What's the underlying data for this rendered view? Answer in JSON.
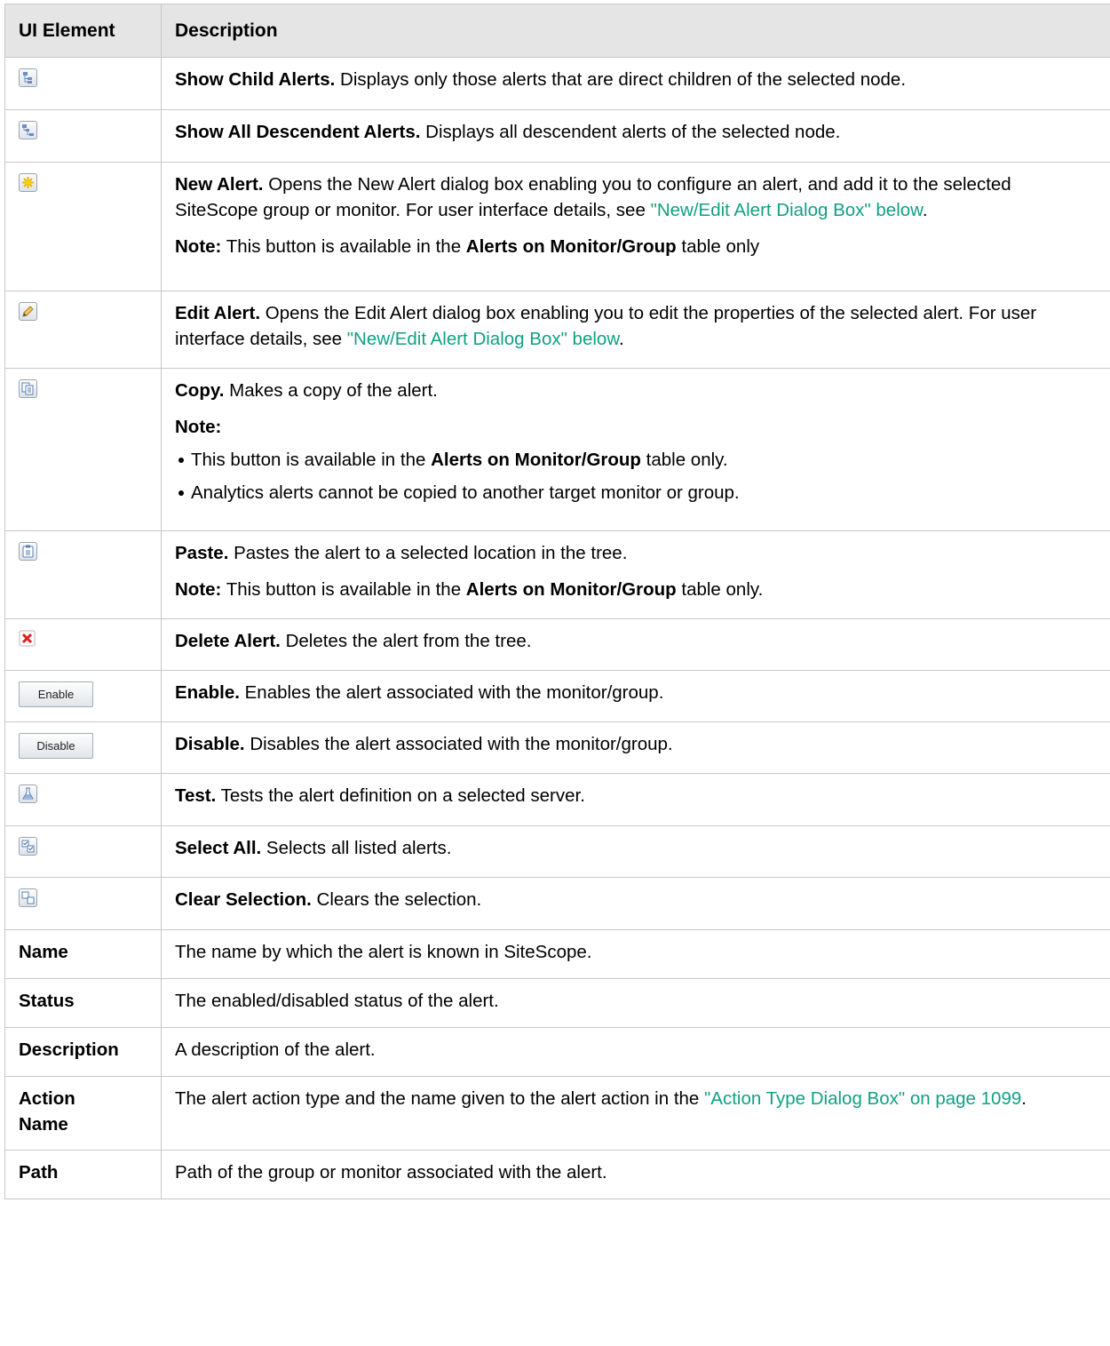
{
  "header": {
    "col1": "UI Element",
    "col2": "Description"
  },
  "rows": [
    {
      "icon": "show-child-alerts-icon",
      "title": "Show Child Alerts.",
      "text": " Displays only those alerts that are direct children of the selected node."
    },
    {
      "icon": "show-all-descendent-alerts-icon",
      "title": "Show All Descendent Alerts.",
      "text": " Displays all descendent alerts of the selected node."
    },
    {
      "icon": "new-alert-icon",
      "title": "New Alert.",
      "text": " Opens the New Alert dialog box enabling you to configure an alert, and add it to the selected SiteScope group or monitor. For user interface details, see ",
      "link": "\"New/Edit Alert Dialog Box\" below",
      "tail": ".",
      "note_label": "Note:",
      "note_pre": " This button is available in the ",
      "note_bold": "Alerts on Monitor/Group",
      "note_post": " table only"
    },
    {
      "icon": "edit-alert-icon",
      "title": "Edit Alert.",
      "text": " Opens the Edit Alert dialog box enabling you to edit the properties of the selected alert. For user interface details, see ",
      "link": "\"New/Edit Alert Dialog Box\" below",
      "tail": "."
    },
    {
      "icon": "copy-icon",
      "title": "Copy.",
      "text": " Makes a copy of the alert.",
      "note_label": "Note:",
      "bullet1_pre": "This button is available in the ",
      "bullet1_bold": "Alerts on Monitor/Group",
      "bullet1_post": " table only.",
      "bullet2": "Analytics alerts cannot be copied to another target monitor or group."
    },
    {
      "icon": "paste-icon",
      "title": "Paste.",
      "text": " Pastes the alert to a selected location in the tree.",
      "note_label": "Note:",
      "note_pre": " This button is available in the ",
      "note_bold": "Alerts on Monitor/Group",
      "note_post": " table only."
    },
    {
      "icon": "delete-alert-icon",
      "title": "Delete Alert.",
      "text": " Deletes the alert from the tree."
    },
    {
      "button": "Enable",
      "title": "Enable.",
      "text": " Enables the alert associated with the monitor/group."
    },
    {
      "button": "Disable",
      "title": "Disable.",
      "text": " Disables the alert associated with the monitor/group."
    },
    {
      "icon": "test-flask-icon",
      "title": "Test.",
      "text": " Tests the alert definition on a selected server."
    },
    {
      "icon": "select-all-icon",
      "title": "Select All.",
      "text": " Selects all listed alerts."
    },
    {
      "icon": "clear-selection-icon",
      "title": "Clear Selection.",
      "text": " Clears the selection."
    },
    {
      "label": "Name",
      "text": "The name by which the alert is known in SiteScope."
    },
    {
      "label": "Status",
      "text": "The enabled/disabled status of the alert."
    },
    {
      "label": "Description",
      "text": "A description of the alert."
    },
    {
      "label": "Action Name",
      "text": "The alert action type and the name given to the alert action in the ",
      "link": "\"Action Type Dialog Box\" on page 1099",
      "tail": "."
    },
    {
      "label": "Path",
      "text": "Path of the group or monitor associated with the alert."
    }
  ]
}
